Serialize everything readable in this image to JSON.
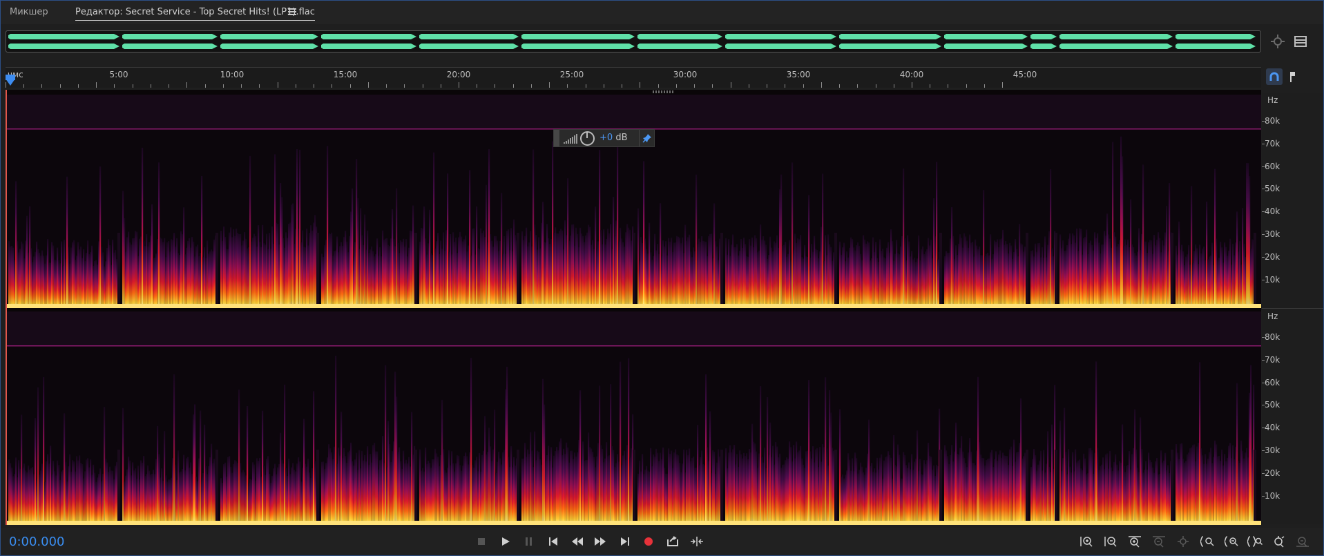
{
  "tabs": {
    "mixer_label": "Микшер",
    "editor_label": "Редактор: Secret Service - Top Secret Hits! (LP1).flac"
  },
  "timeline": {
    "unit_label": "чмс",
    "labels": [
      "5:00",
      "10:00",
      "15:00",
      "20:00",
      "25:00",
      "30:00",
      "35:00",
      "40:00",
      "45:00"
    ]
  },
  "frequency_axis": {
    "unit": "Hz",
    "labels": [
      "80k",
      "70k",
      "60k",
      "50k",
      "40k",
      "30k",
      "20k",
      "10k"
    ]
  },
  "hud": {
    "gain_value": "+0",
    "gain_unit": "dB"
  },
  "transport": {
    "timecode": "0:00.000"
  },
  "colors": {
    "accent": "#3a8ef2",
    "waveform": "#5fe0a8",
    "record": "#e8323a"
  },
  "icons": {
    "tab_menu": "hamburger-menu-icon",
    "overview_zoom": "zoom-lens-icon",
    "overview_panel": "panel-toggle-icon",
    "ruler_snap": "magnet-icon",
    "ruler_marker": "marker-pin-icon",
    "hud_pin": "pin-icon"
  }
}
